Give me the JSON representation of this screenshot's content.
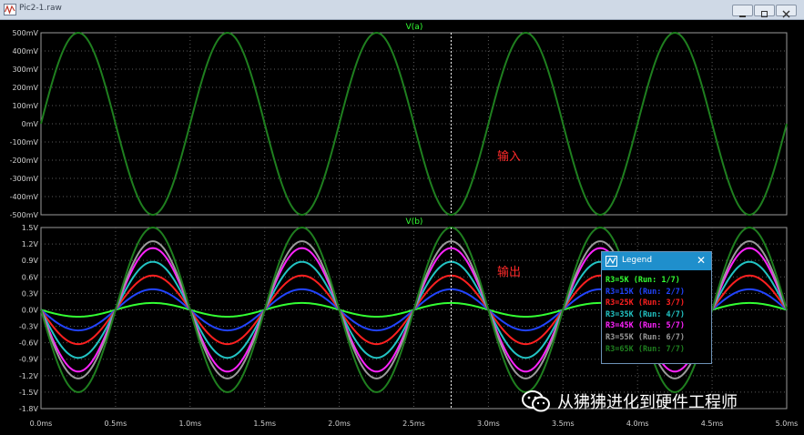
{
  "window": {
    "title": "Pic2-1.raw",
    "buttons": [
      "minimize",
      "restore",
      "close"
    ]
  },
  "annotations": {
    "input_label": "输入",
    "output_label": "输出"
  },
  "legend": {
    "title": "Legend",
    "entries": [
      {
        "label": "R3=5K  (Run: 1/7)",
        "color": "#33ff33"
      },
      {
        "label": "R3=15K (Run: 2/7)",
        "color": "#2244ff"
      },
      {
        "label": "R3=25K (Run: 3/7)",
        "color": "#ff2020"
      },
      {
        "label": "R3=35K (Run: 4/7)",
        "color": "#22c4c4"
      },
      {
        "label": "R3=45K (Run: 5/7)",
        "color": "#ff22ff"
      },
      {
        "label": "R3=55K (Run: 6/7)",
        "color": "#9a9a9a"
      },
      {
        "label": "R3=65K (Run: 7/7)",
        "color": "#1f7f1f"
      }
    ]
  },
  "watermark": {
    "text": "从狒狒进化到硬件工程师"
  },
  "chart_data": [
    {
      "type": "line",
      "title": "V(a)",
      "xlim": [
        0,
        5.0
      ],
      "ylim": [
        -500,
        500
      ],
      "x_ticks": [
        "0.0ms",
        "0.5ms",
        "1.0ms",
        "1.5ms",
        "2.0ms",
        "2.5ms",
        "3.0ms",
        "3.5ms",
        "4.0ms",
        "4.5ms",
        "5.0ms"
      ],
      "y_ticks": [
        "500mV",
        "400mV",
        "300mV",
        "200mV",
        "100mV",
        "0mV",
        "-100mV",
        "-200mV",
        "-300mV",
        "-400mV",
        "-500mV"
      ],
      "grid": true,
      "cursor_x": 2.75,
      "series": [
        {
          "amplitude_mV": 500,
          "frequency_kHz": 1,
          "phase": "sine",
          "color": "#1f7f1f"
        }
      ]
    },
    {
      "type": "line",
      "title": "V(b)",
      "xlim": [
        0,
        5.0
      ],
      "ylim": [
        -1.8,
        1.5
      ],
      "x_ticks": [
        "0.0ms",
        "0.5ms",
        "1.0ms",
        "1.5ms",
        "2.0ms",
        "2.5ms",
        "3.0ms",
        "3.5ms",
        "4.0ms",
        "4.5ms",
        "5.0ms"
      ],
      "y_ticks": [
        "1.5V",
        "1.2V",
        "0.9V",
        "0.6V",
        "0.3V",
        "0.0V",
        "-0.3V",
        "-0.6V",
        "-0.9V",
        "-1.2V",
        "-1.5V",
        "-1.8V"
      ],
      "grid": true,
      "cursor_x": 2.75,
      "series": [
        {
          "name": "R3=5K",
          "amplitude_V": 0.125,
          "frequency_kHz": 1,
          "phase": "inverted",
          "color": "#33ff33"
        },
        {
          "name": "R3=15K",
          "amplitude_V": 0.375,
          "frequency_kHz": 1,
          "phase": "inverted",
          "color": "#2244ff"
        },
        {
          "name": "R3=25K",
          "amplitude_V": 0.625,
          "frequency_kHz": 1,
          "phase": "inverted",
          "color": "#ff2020"
        },
        {
          "name": "R3=35K",
          "amplitude_V": 0.875,
          "frequency_kHz": 1,
          "phase": "inverted",
          "color": "#22c4c4"
        },
        {
          "name": "R3=45K",
          "amplitude_V": 1.125,
          "frequency_kHz": 1,
          "phase": "inverted",
          "color": "#ff22ff"
        },
        {
          "name": "R3=55K",
          "amplitude_V": 1.25,
          "frequency_kHz": 1,
          "phase": "inverted",
          "color": "#9a9a9a"
        },
        {
          "name": "R3=65K",
          "amplitude_V": 1.5,
          "frequency_kHz": 1,
          "phase": "inverted",
          "color": "#1f7f1f"
        }
      ]
    }
  ]
}
